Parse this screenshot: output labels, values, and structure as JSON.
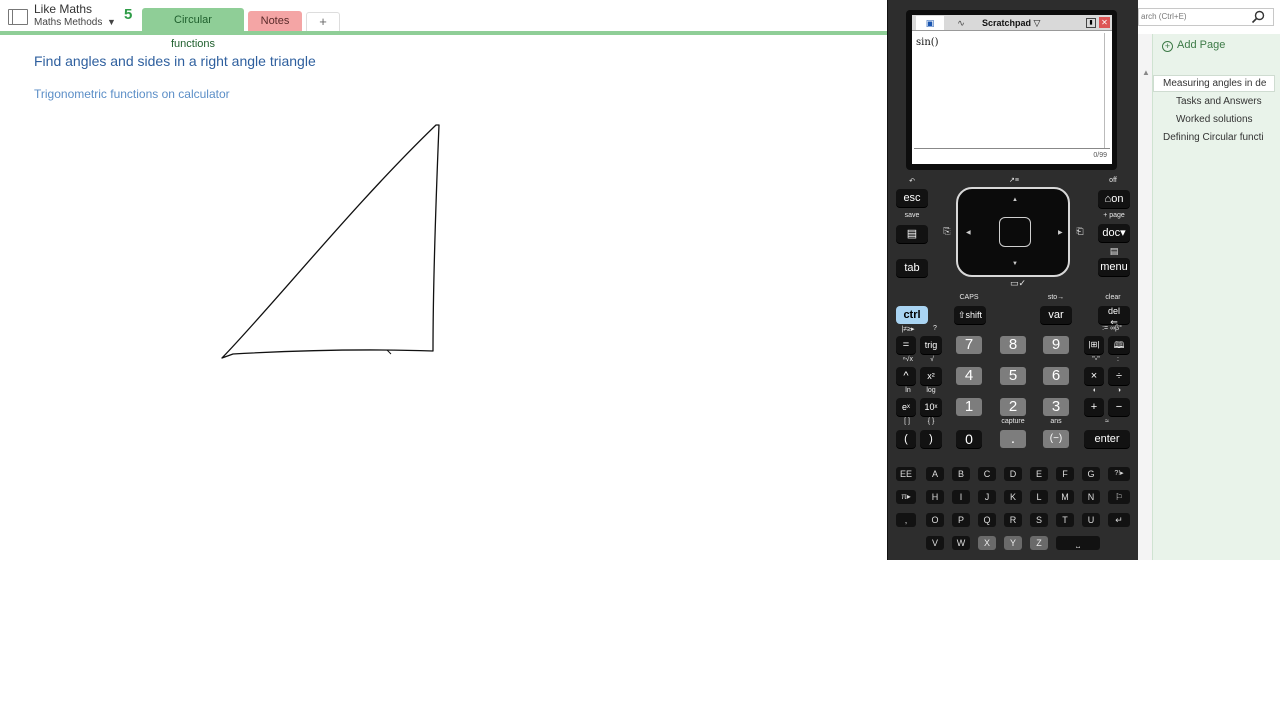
{
  "notebook": {
    "name": "Like Maths",
    "section": "Maths Methods",
    "dropdown_icon": "caret-down-icon",
    "sync_icon": "5"
  },
  "tabs": [
    {
      "label": "Circular functions",
      "color": "#8fce97"
    },
    {
      "label": "Notes",
      "color": "#f4a5a5"
    },
    {
      "label": "+"
    }
  ],
  "page": {
    "title": "Find angles and sides in a right angle triangle",
    "subtitle": "Trigonometric functions on calculator",
    "ink": "hand-drawn-triangle"
  },
  "right_pane": {
    "search_placeholder": "arch (Ctrl+E)",
    "add_page": "Add Page",
    "pages": [
      "Measuring angles in de",
      "Tasks and Answers",
      "Worked solutions",
      "Defining Circular functi"
    ]
  },
  "calculator": {
    "screen": {
      "tab_title": "Scratchpad",
      "expression": "sin()",
      "status": "0/99"
    },
    "labels": {
      "undo": "↶",
      "off": "off",
      "save": "save",
      "page_plus": "+ page",
      "caps": "CAPS",
      "sto": "sto→",
      "clear": "clear",
      "capture": "capture",
      "ans": "ans",
      "ln": "ln",
      "log": "log",
      "approx": "≈"
    },
    "keys": {
      "esc": "esc",
      "on": "on",
      "doc": "doc",
      "tab": "tab",
      "menu": "menu",
      "ctrl": "ctrl",
      "shift": "⇧shift",
      "var": "var",
      "del": "del",
      "equals": "=",
      "trig": "trig",
      "caret": "^",
      "x2": "x²",
      "ex": "eˣ",
      "tenx": "10ˣ",
      "lparen": "(",
      "rparen": ")",
      "times": "×",
      "divide": "÷",
      "plus": "+",
      "minus": "−",
      "negative": "(−)",
      "enter": "enter",
      "dot": ".",
      "digits_row1": [
        "7",
        "8",
        "9"
      ],
      "digits_row2": [
        "4",
        "5",
        "6"
      ],
      "digits_row3": [
        "1",
        "2",
        "3"
      ],
      "zero": "0",
      "ee": "EE",
      "pi": "π▸",
      "comma": ",",
      "question": "?!▸",
      "flag": "⚐",
      "return": "↵",
      "space": "⎵",
      "alpha_row1": [
        "A",
        "B",
        "C",
        "D",
        "E",
        "F",
        "G"
      ],
      "alpha_row2": [
        "H",
        "I",
        "J",
        "K",
        "L",
        "M",
        "N"
      ],
      "alpha_row3": [
        "O",
        "P",
        "Q",
        "R",
        "S",
        "T",
        "U"
      ],
      "alpha_row4": [
        "V",
        "W",
        "X",
        "Y",
        "Z"
      ]
    }
  }
}
